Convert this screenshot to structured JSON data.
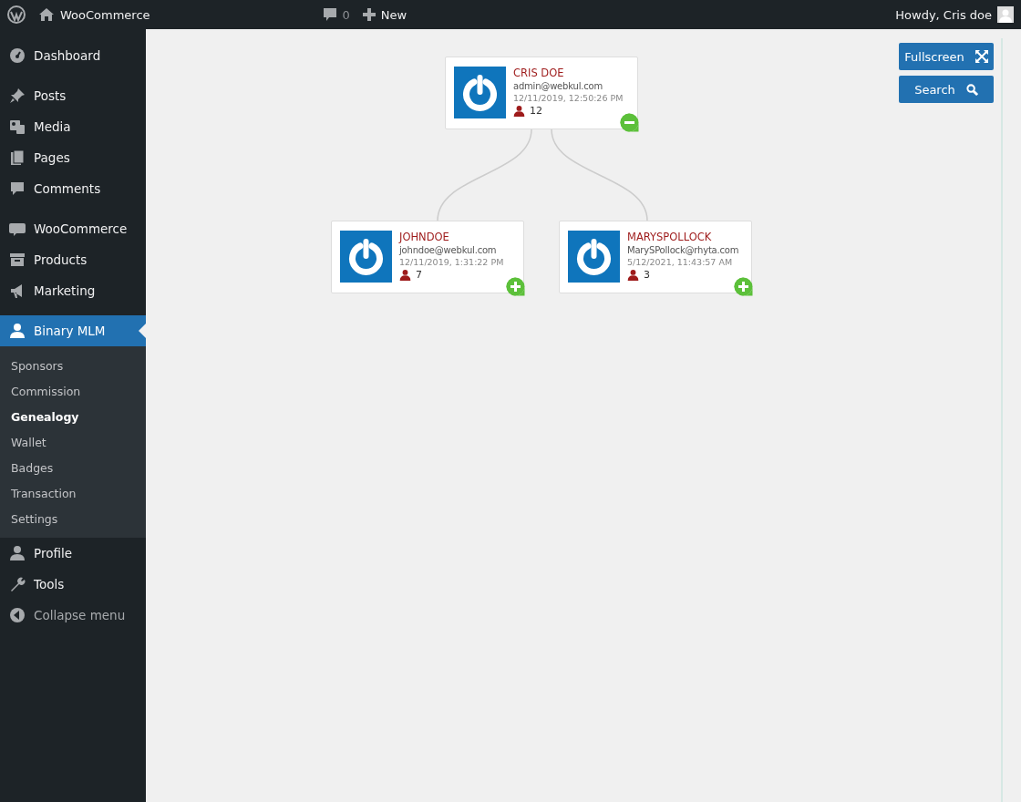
{
  "admin_bar": {
    "site_name": "WooCommerce",
    "comments_count": "0",
    "new_label": "New",
    "greeting": "Howdy, Cris doe"
  },
  "sidebar": {
    "groups": [
      {
        "items": [
          {
            "label": "Dashboard",
            "selected": false
          }
        ]
      },
      {
        "items": [
          {
            "label": "Posts",
            "selected": false
          },
          {
            "label": "Media",
            "selected": false
          },
          {
            "label": "Pages",
            "selected": false
          },
          {
            "label": "Comments",
            "selected": false
          }
        ]
      },
      {
        "items": [
          {
            "label": "WooCommerce",
            "selected": false
          },
          {
            "label": "Products",
            "selected": false
          },
          {
            "label": "Marketing",
            "selected": false
          }
        ]
      },
      {
        "items": [
          {
            "label": "Binary MLM",
            "selected": true,
            "submenu": [
              {
                "label": "Sponsors",
                "selected": false
              },
              {
                "label": "Commission",
                "selected": false
              },
              {
                "label": "Genealogy",
                "selected": true
              },
              {
                "label": "Wallet",
                "selected": false
              },
              {
                "label": "Badges",
                "selected": false
              },
              {
                "label": "Transaction",
                "selected": false
              },
              {
                "label": "Settings",
                "selected": false
              }
            ]
          },
          {
            "label": "Profile",
            "selected": false
          },
          {
            "label": "Tools",
            "selected": false
          }
        ]
      }
    ],
    "collapse_label": "Collapse menu"
  },
  "toolbar": {
    "buttons": [
      "Fullscreen",
      "Search"
    ]
  },
  "tree": {
    "name": "CRIS DOE",
    "email": "admin@webkul.com",
    "date": "12/11/2019, 12:50:26 PM",
    "count": "12",
    "expanded": true,
    "children": [
      {
        "name": "JOHNDOE",
        "email": "johndoe@webkul.com",
        "date": "12/11/2019, 1:31:22 PM",
        "count": "7",
        "expanded": false
      },
      {
        "name": "MARYSPOLLOCK",
        "email": "MarySPollock@rhyta.com",
        "date": "5/12/2021, 11:43:57 AM",
        "count": "3",
        "expanded": false
      }
    ]
  }
}
